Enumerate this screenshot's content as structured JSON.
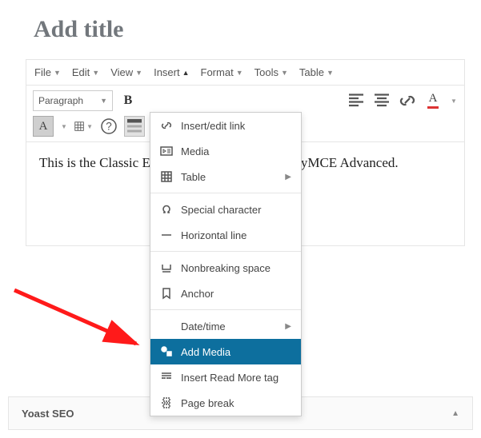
{
  "page_title": "Add title",
  "menubar": {
    "file": "File",
    "edit": "Edit",
    "view": "View",
    "insert": "Insert",
    "format": "Format",
    "tools": "Tools",
    "table": "Table"
  },
  "toolbar": {
    "format_selector": "Paragraph",
    "bold_glyph": "B"
  },
  "dropdown": {
    "insert_edit_link": "Insert/edit link",
    "media": "Media",
    "table": "Table",
    "special_char": "Special character",
    "horizontal_line": "Horizontal line",
    "nonbreaking_space": "Nonbreaking space",
    "anchor": "Anchor",
    "date_time": "Date/time",
    "add_media": "Add Media",
    "read_more": "Insert Read More tag",
    "page_break": "Page break"
  },
  "content_text": "This is the Classic Editor with TinyMCE Advanced.",
  "content_visible_left": "This is the Classic E",
  "content_visible_right": "yMCE Advanced.",
  "footer_panel": "Yoast SEO"
}
